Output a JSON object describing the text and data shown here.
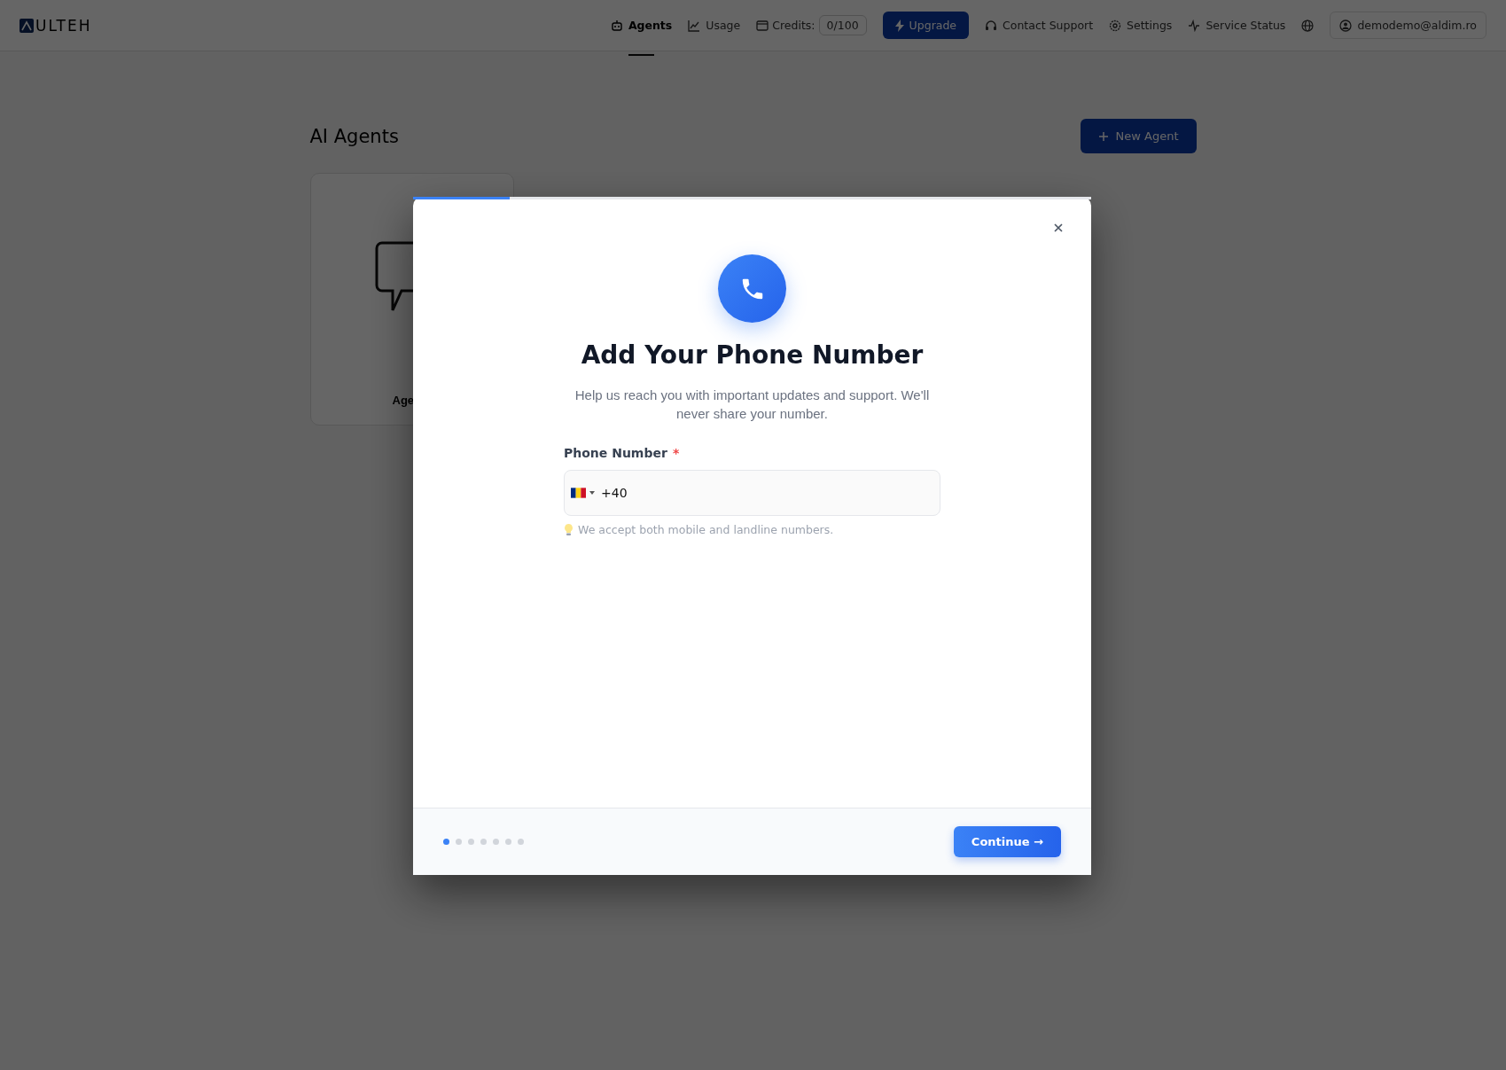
{
  "nav": {
    "brand": "ULTEH",
    "links": [
      {
        "label": "Agents",
        "selected": true
      },
      {
        "label": "Usage",
        "selected": false
      }
    ],
    "credits": {
      "label": "Credits:",
      "value": "0/100"
    },
    "upgrade": "Upgrade",
    "links2": [
      {
        "label": "Contact Support"
      },
      {
        "label": "Settings"
      },
      {
        "label": "Service Status"
      }
    ],
    "user": "demodemo@aldim.ro"
  },
  "page": {
    "title": "AI Agents",
    "new_button": "New Agent",
    "card_label": "Age"
  },
  "modal": {
    "progress": {
      "level": 0.143
    },
    "title": "Add Your Phone Number",
    "subtitle": "Help us reach you with important updates and support. We'll never share your number.",
    "field": {
      "label": "Phone Number",
      "required": true,
      "required_mark": "*",
      "value": "+40",
      "hint": "We accept both mobile and landline numbers."
    },
    "steps": [
      {
        "selected": true
      },
      {
        "selected": false
      },
      {
        "selected": false
      },
      {
        "selected": false
      },
      {
        "selected": false
      },
      {
        "selected": false
      },
      {
        "selected": false
      }
    ],
    "continue": "Continue →"
  }
}
